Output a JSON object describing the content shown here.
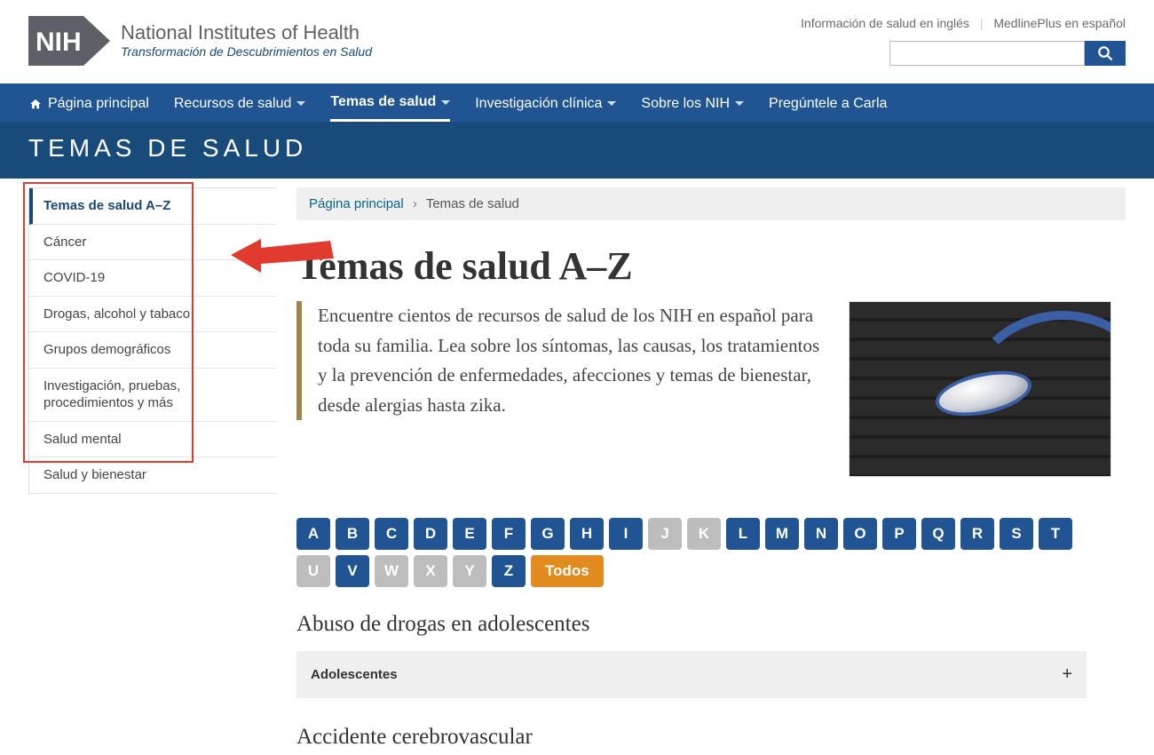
{
  "brand": {
    "line1": "National Institutes of Health",
    "line2": "Transformación de Descubrimientos en Salud",
    "logo_text": "NIH"
  },
  "util_links": [
    "Información de salud en inglés",
    "MedlinePlus en español"
  ],
  "search": {
    "value": ""
  },
  "nav": [
    {
      "label": "Página principal",
      "icon": "home"
    },
    {
      "label": "Recursos de salud",
      "dropdown": true
    },
    {
      "label": "Temas de salud",
      "dropdown": true,
      "active": true
    },
    {
      "label": "Investigación clínica",
      "dropdown": true
    },
    {
      "label": "Sobre los NIH",
      "dropdown": true
    },
    {
      "label": "Pregúntele a Carla"
    }
  ],
  "band_title": "TEMAS DE SALUD",
  "sidebar": [
    {
      "label": "Temas de salud A–Z",
      "selected": true
    },
    {
      "label": "Cáncer"
    },
    {
      "label": "COVID-19"
    },
    {
      "label": "Drogas, alcohol y tabaco"
    },
    {
      "label": "Grupos demográficos"
    },
    {
      "label": "Investigación, pruebas, procedimientos y más"
    },
    {
      "label": "Salud mental"
    },
    {
      "label": "Salud y bienestar"
    }
  ],
  "crumbs": {
    "home": "Página principal",
    "current": "Temas de salud"
  },
  "page_title": "Temas de salud A–Z",
  "intro_text": "Encuentre cientos de recursos de salud de los NIH en español para toda su familia. Lea sobre los síntomas, las causas, los tratamientos y la prevención de enfermedades, afecciones y temas de bienestar, desde alergias hasta zika.",
  "alphabet": [
    {
      "l": "A"
    },
    {
      "l": "B"
    },
    {
      "l": "C"
    },
    {
      "l": "D"
    },
    {
      "l": "E"
    },
    {
      "l": "F"
    },
    {
      "l": "G"
    },
    {
      "l": "H"
    },
    {
      "l": "I"
    },
    {
      "l": "J",
      "disabled": true
    },
    {
      "l": "K",
      "disabled": true
    },
    {
      "l": "L"
    },
    {
      "l": "M"
    },
    {
      "l": "N"
    },
    {
      "l": "O"
    },
    {
      "l": "P"
    },
    {
      "l": "Q"
    },
    {
      "l": "R"
    },
    {
      "l": "S"
    },
    {
      "l": "T"
    },
    {
      "l": "U",
      "disabled": true
    },
    {
      "l": "V"
    },
    {
      "l": "W",
      "disabled": true
    },
    {
      "l": "X",
      "disabled": true
    },
    {
      "l": "Y",
      "disabled": true
    },
    {
      "l": "Z"
    }
  ],
  "alphabet_all": "Todos",
  "topics": [
    {
      "heading": "Abuso de drogas en adolescentes",
      "accordion": "Adolescentes"
    },
    {
      "heading": "Accidente cerebrovascular"
    }
  ]
}
